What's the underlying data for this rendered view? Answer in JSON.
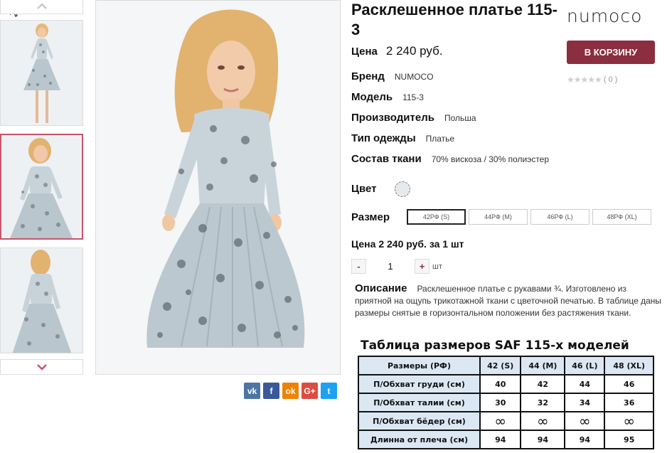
{
  "thumbs": {
    "up_icon": "chevron-up-icon",
    "down_icon": "chevron-down-icon",
    "items": [
      {
        "pose": "front"
      },
      {
        "pose": "front-close",
        "active": true
      },
      {
        "pose": "back"
      }
    ]
  },
  "social": [
    {
      "label": "vk",
      "color": "#4c75a3"
    },
    {
      "label": "f",
      "color": "#3b5998"
    },
    {
      "label": "ok",
      "color": "#ee8208"
    },
    {
      "label": "G+",
      "color": "#dc4e41"
    },
    {
      "label": "t",
      "color": "#1da1f2"
    }
  ],
  "product": {
    "title": "Расклешенное платье 115-3",
    "brand_logo": "NUMOCO",
    "cart_button": "В КОРЗИНУ",
    "rating_stars": "★★★★★",
    "rating_count": "( 0 )",
    "price_label": "Цена",
    "price_value": "2 240 руб.",
    "specs": [
      {
        "label": "Бренд",
        "value": "NUMOCO"
      },
      {
        "label": "Модель",
        "value": "115-3"
      },
      {
        "label": "Производитель",
        "value": "Польша"
      },
      {
        "label": "Тип одежды",
        "value": "Платье"
      },
      {
        "label": "Состав ткани",
        "value": "70% вискоза / 30% полиэстер"
      }
    ],
    "color_label": "Цвет",
    "size_label": "Размер",
    "sizes": [
      {
        "label": "42РФ (S)",
        "selected": true
      },
      {
        "label": "44РФ (M)",
        "selected": false
      },
      {
        "label": "46РФ (L)",
        "selected": false
      },
      {
        "label": "48РФ (XL)",
        "selected": false
      }
    ],
    "unit_price": "Цена 2 240 руб. за 1 шт",
    "qty_minus": "-",
    "qty_value": "1",
    "qty_plus": "+",
    "qty_unit": "шт",
    "description_label": "Описание",
    "description": "Расклешенное платье с рукавами ¾. Изготовлено из приятной на ощупь трикотажной ткани с цветочной печатью. В таблице даны размеры снятые в горизонтальном положении без растяжения ткани."
  },
  "size_table": {
    "title": "Таблица размеров SAF 115-х моделей",
    "header": [
      "Размеры (РФ)",
      "42 (S)",
      "44 (M)",
      "46 (L)",
      "48 (XL)"
    ],
    "rows": [
      [
        "П/Обхват груди (см)",
        "40",
        "42",
        "44",
        "46"
      ],
      [
        "П/Обхват талии (см)",
        "30",
        "32",
        "34",
        "36"
      ],
      [
        "П/Обхват бёдер (см)",
        "∞",
        "∞",
        "∞",
        "∞"
      ],
      [
        "Длинна от плеча (см)",
        "94",
        "94",
        "94",
        "95"
      ]
    ]
  }
}
